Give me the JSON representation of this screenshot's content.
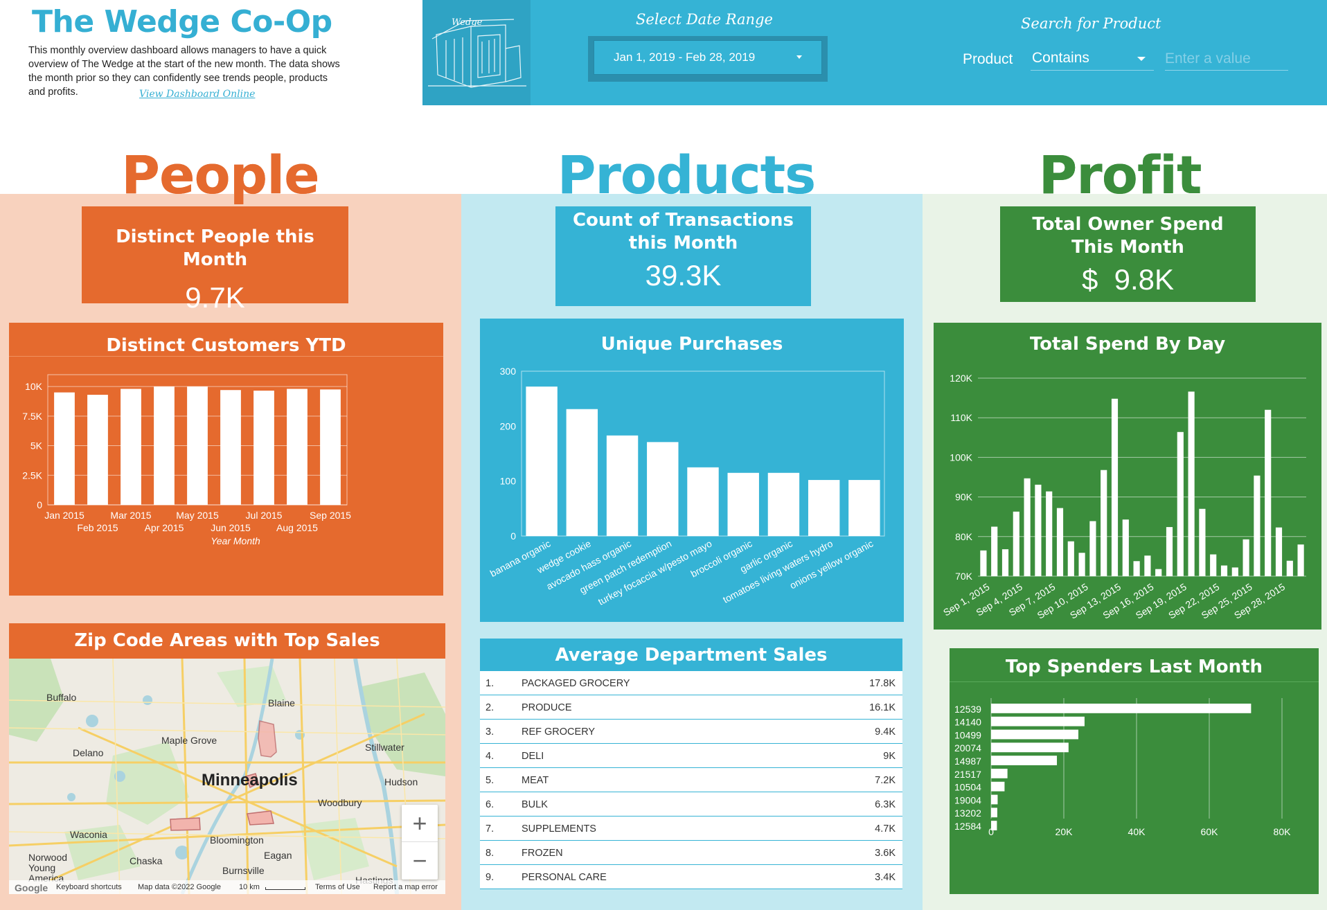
{
  "header": {
    "title": "The Wedge Co-Op",
    "description": "This monthly overview dashboard allows managers to have a quick overview of The Wedge at the start of the new month. The data shows the month prior so they can confidently see trends people, products and profits.",
    "link_label": "View Dashboard Online",
    "logo_text": "Wedge",
    "date_label": "Select Date Range",
    "date_value": "Jan 1, 2019 - Feb 28, 2019",
    "search_label": "Search for Product",
    "product_label": "Product",
    "product_operator": "Contains",
    "product_placeholder": "Enter a value"
  },
  "colors": {
    "people": "#e56a2e",
    "products": "#35b3d5",
    "profit": "#3b8d3c",
    "people_bg": "#f8d2be",
    "products_bg": "#c2e9f1",
    "profit_bg": "#e9f3e7"
  },
  "sections": {
    "people": "People",
    "products": "Products",
    "profit": "Profit"
  },
  "kpis": {
    "people": {
      "label": "Distinct People this Month",
      "value": "9.7K"
    },
    "products": {
      "label_line1": "Count of Transactions",
      "label_line2": "this Month",
      "value": "39.3K"
    },
    "profit": {
      "label_line1": "Total Owner Spend",
      "label_line2": "This Month",
      "value": "$  9.8K"
    }
  },
  "panels": {
    "customers_ytd": "Distinct Customers YTD",
    "zip_map": "Zip Code Areas with Top Sales",
    "unique_purchases": "Unique Purchases",
    "dept_sales": "Average Department Sales",
    "spend_by_day": "Total Spend By Day",
    "top_spenders": "Top Spenders Last Month"
  },
  "map": {
    "places": [
      "Buffalo",
      "Blaine",
      "Maple Grove",
      "Stillwater",
      "Delano",
      "Minneapolis",
      "Hudson",
      "Woodbury",
      "Waconia",
      "Bloomington",
      "Norwood Young America",
      "Chaska",
      "Eagan",
      "Burnsville",
      "Hastings"
    ],
    "footer": [
      "Keyboard shortcuts",
      "Map data ©2022 Google",
      "10 km",
      "Terms of Use",
      "Report a map error"
    ],
    "google": "Google",
    "zoom_in": "+",
    "zoom_out": "−"
  },
  "dept_sales": [
    {
      "rank": "1.",
      "name": "PACKAGED GROCERY",
      "value": "17.8K"
    },
    {
      "rank": "2.",
      "name": "PRODUCE",
      "value": "16.1K"
    },
    {
      "rank": "3.",
      "name": "REF GROCERY",
      "value": "9.4K"
    },
    {
      "rank": "4.",
      "name": "DELI",
      "value": "9K"
    },
    {
      "rank": "5.",
      "name": "MEAT",
      "value": "7.2K"
    },
    {
      "rank": "6.",
      "name": "BULK",
      "value": "6.3K"
    },
    {
      "rank": "7.",
      "name": "SUPPLEMENTS",
      "value": "4.7K"
    },
    {
      "rank": "8.",
      "name": "FROZEN",
      "value": "3.6K"
    },
    {
      "rank": "9.",
      "name": "PERSONAL CARE",
      "value": "3.4K"
    }
  ],
  "chart_data": [
    {
      "id": "customers",
      "type": "bar",
      "title": "Distinct Customers YTD",
      "xlabel": "Year Month",
      "ylabel": "",
      "categories": [
        "Jan 2015",
        "Feb 2015",
        "Mar 2015",
        "Apr 2015",
        "May 2015",
        "Jun 2015",
        "Jul 2015",
        "Aug 2015",
        "Sep 2015"
      ],
      "values": [
        9500,
        9300,
        9800,
        10000,
        10000,
        9700,
        9650,
        9800,
        9750
      ],
      "ylim": [
        0,
        11000
      ],
      "yticks": [
        0,
        2500,
        5000,
        7500,
        10000
      ],
      "ytick_labels": [
        "0",
        "2.5K",
        "5K",
        "7.5K",
        "10K"
      ],
      "grid": true
    },
    {
      "id": "unique",
      "type": "bar",
      "title": "Unique Purchases",
      "categories": [
        "banana organic",
        "wedge cookie",
        "avocado hass organic",
        "green patch redemption",
        "turkey focaccia w/pesto mayo",
        "broccoli organic",
        "garlic organic",
        "tomatoes living waters hydro",
        "onions yellow organic"
      ],
      "values": [
        272,
        231,
        183,
        171,
        125,
        115,
        115,
        102,
        102
      ],
      "ylim": [
        0,
        300
      ],
      "yticks": [
        0,
        100,
        200,
        300
      ],
      "ytick_labels": [
        "0",
        "100",
        "200",
        "300"
      ],
      "grid": false
    },
    {
      "id": "spend",
      "type": "bar",
      "title": "Total Spend By Day",
      "categories": [
        "Sep 1, 2015",
        "Sep 2, 2015",
        "Sep 3, 2015",
        "Sep 4, 2015",
        "Sep 5, 2015",
        "Sep 6, 2015",
        "Sep 7, 2015",
        "Sep 8, 2015",
        "Sep 9, 2015",
        "Sep 10, 2015",
        "Sep 11, 2015",
        "Sep 12, 2015",
        "Sep 13, 2015",
        "Sep 14, 2015",
        "Sep 15, 2015",
        "Sep 16, 2015",
        "Sep 17, 2015",
        "Sep 18, 2015",
        "Sep 19, 2015",
        "Sep 20, 2015",
        "Sep 21, 2015",
        "Sep 22, 2015",
        "Sep 23, 2015",
        "Sep 24, 2015",
        "Sep 25, 2015",
        "Sep 26, 2015",
        "Sep 27, 2015",
        "Sep 28, 2015",
        "Sep 29, 2015",
        "Sep 30, 2015"
      ],
      "tick_labels": [
        "Sep 1, 2015",
        "Sep 4, 2015",
        "Sep 7, 2015",
        "Sep 10, 2015",
        "Sep 13, 2015",
        "Sep 16, 2015",
        "Sep 19, 2015",
        "Sep 22, 2015",
        "Sep 25, 2015",
        "Sep 28, 2015"
      ],
      "values": [
        76500,
        82500,
        76800,
        86300,
        94700,
        93100,
        91400,
        87200,
        78800,
        75900,
        83900,
        96800,
        114800,
        84300,
        73800,
        75200,
        71800,
        82400,
        106400,
        116600,
        87000,
        75500,
        72700,
        72200,
        79300,
        95400,
        112000,
        82300,
        73900,
        78000
      ],
      "ylim": [
        70000,
        120000
      ],
      "yticks": [
        70000,
        80000,
        90000,
        100000,
        110000,
        120000
      ],
      "ytick_labels": [
        "70K",
        "80K",
        "90K",
        "100K",
        "110K",
        "120K"
      ],
      "grid": true
    },
    {
      "id": "spenders",
      "type": "bar",
      "orientation": "horizontal",
      "title": "Top Spenders Last Month",
      "categories": [
        "12539",
        "14140",
        "10499",
        "20074",
        "14987",
        "21517",
        "10504",
        "19004",
        "13202",
        "12584"
      ],
      "values": [
        71500,
        25700,
        24000,
        21300,
        18100,
        4500,
        3700,
        1800,
        1700,
        1600
      ],
      "xlim": [
        0,
        80000
      ],
      "xticks": [
        0,
        20000,
        40000,
        60000,
        80000
      ],
      "xtick_labels": [
        "0",
        "20K",
        "40K",
        "60K",
        "80K"
      ],
      "grid": true
    }
  ]
}
